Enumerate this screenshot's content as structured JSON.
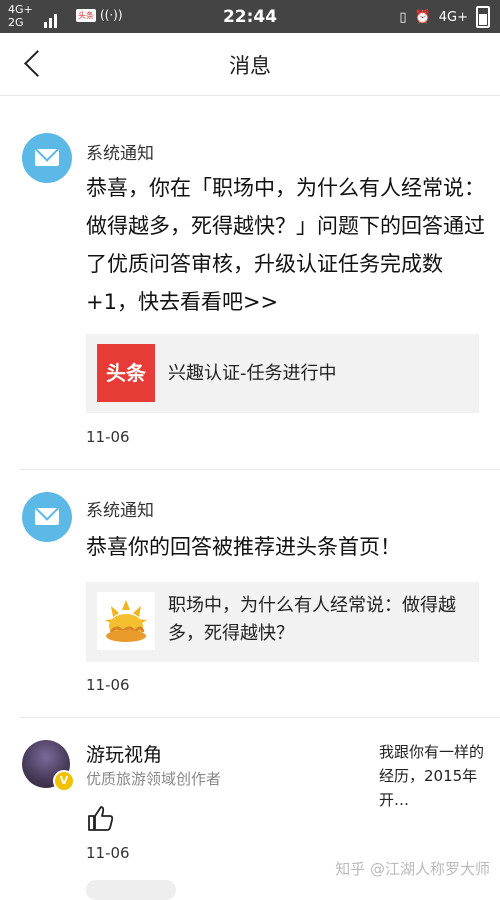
{
  "status_bar": {
    "network_top": "4G+",
    "network_bottom": "2G",
    "app_badge": "头条",
    "time": "22:44",
    "network_right": "4G+"
  },
  "nav": {
    "title": "消息",
    "back_icon": "chevron-left-icon"
  },
  "messages": [
    {
      "sender": "系统通知",
      "text": "恭喜，你在「职场中，为什么有人经常说：做得越多，死得越快？」问题下的回答通过了优质问答审核，升级认证任务完成数+1，快去看看吧>>",
      "card_logo": "头条",
      "card_text": "兴趣认证-任务进行中",
      "date": "11-06"
    },
    {
      "sender": "系统通知",
      "text": "恭喜你的回答被推荐进头条首页！",
      "card_text": "职场中，为什么有人经常说：做得越多，死得越快？",
      "date": "11-06"
    }
  ],
  "user_item": {
    "name": "游玩视角",
    "title": "优质旅游领域创作者",
    "quote": "我跟你有一样的经历，2015年开…",
    "date": "11-06",
    "verified_mark": "V"
  },
  "watermark": "知乎 @江湖人称罗大师",
  "colors": {
    "status_bar": "#444444",
    "system_avatar": "#5cb8e6",
    "toutiao_red": "#e63b36",
    "card_bg": "#f2f2f2"
  }
}
